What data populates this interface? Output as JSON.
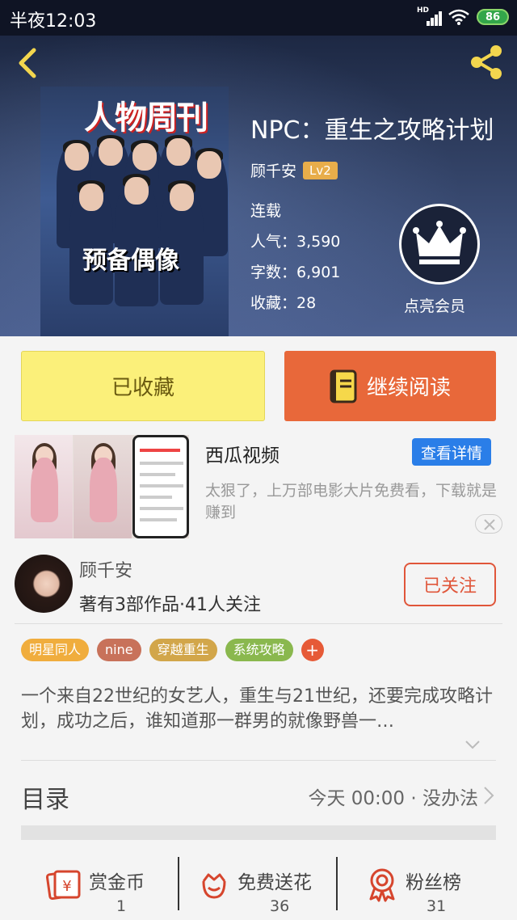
{
  "status_bar": {
    "time": "半夜12:03",
    "battery": "86"
  },
  "book": {
    "title": "NPC：重生之攻略计划",
    "author": "顾千安",
    "author_level": "Lv2",
    "status": "连载",
    "popularity": "人气：3,590",
    "word_count": "字数：6,901",
    "favorites": "收藏：28",
    "vip_label": "点亮会员",
    "cover": {
      "magazine": "人物周刊",
      "magazine_tag": "",
      "title": "预备偶像",
      "subtitle": ""
    }
  },
  "actions": {
    "collected_label": "已收藏",
    "continue_label": "继续阅读"
  },
  "ad": {
    "title": "西瓜视频",
    "detail_button": "查看详情",
    "description": "太狠了，上万部电影大片免费看，下载就是赚到"
  },
  "author_card": {
    "name": "顾千安",
    "stats": "著有3部作品·41人关注",
    "follow_label": "已关注"
  },
  "tags": [
    {
      "label": "明星同人",
      "color": "#f0ad3d"
    },
    {
      "label": "nine",
      "color": "#c8725a"
    },
    {
      "label": "穿越重生",
      "color": "#d2a64a"
    },
    {
      "label": "系统攻略",
      "color": "#8ab84e"
    }
  ],
  "tag_add": "+",
  "synopsis": "一个来自22世纪的女艺人，重生与21世纪，还要完成攻略计划，成功之后，谁知道那一群男的就像野兽一…",
  "toc": {
    "label": "目录",
    "latest": "今天 00:00 · 没办法"
  },
  "bottom_bar": {
    "reward": {
      "label": "赏金币",
      "count": "1"
    },
    "flowers": {
      "label": "免费送花",
      "count": "36"
    },
    "fans": {
      "label": "粉丝榜",
      "count": "31"
    }
  },
  "colors": {
    "accent_orange": "#e8683a",
    "follow_red": "#e0563a",
    "collected_yellow": "#fbf07a",
    "ad_blue": "#2a7ee8",
    "level_badge": "#e8ad4a"
  }
}
